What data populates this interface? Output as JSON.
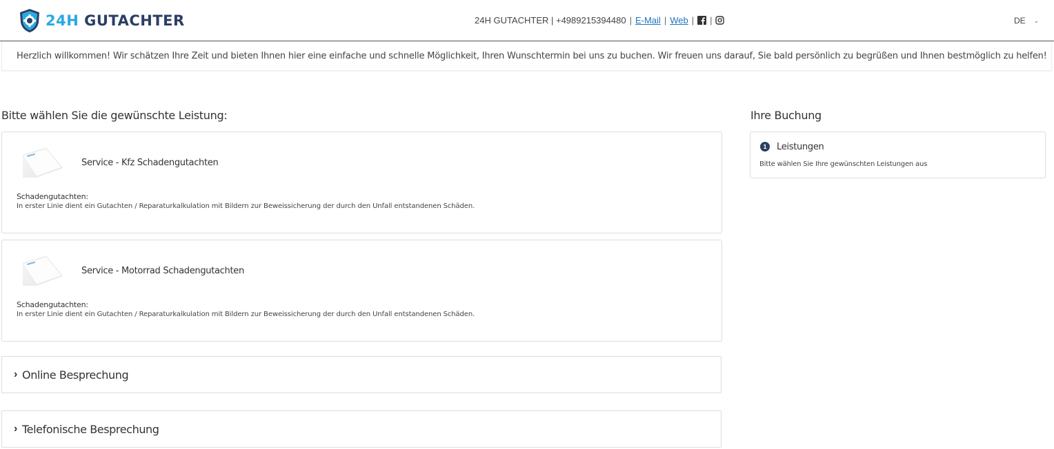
{
  "header": {
    "logo_part1": "24H",
    "logo_part2": " GUTACHTER",
    "contact_prefix": "24H GUTACHTER | +4989215394480",
    "email_label": "E-Mail",
    "web_label": "Web",
    "facebook_icon": "facebook-icon",
    "instagram_icon": "instagram-icon",
    "language": "DE",
    "brand_colors": {
      "light": "#29a9e1",
      "dark": "#2b3e63"
    }
  },
  "welcome": {
    "text": "Herzlich willkommen! Wir schätzen Ihre Zeit und bieten Ihnen hier eine einfache und schnelle Möglichkeit, Ihren Wunschtermin bei uns zu buchen. Wir freuen uns darauf, Sie bald persönlich zu begrüßen und Ihnen bestmöglich zu helfen!"
  },
  "services": {
    "heading": "Bitte wählen Sie die gewünschte Leistung:",
    "items": [
      {
        "title": "Service - Kfz Schadengutachten",
        "desc_heading": "Schadengutachten:",
        "description": "In erster Linie dient ein Gutachten / Reparaturkalkulation mit Bildern zur Beweissicherung der durch den Unfall entstandenen Schäden."
      },
      {
        "title": "Service - Motorrad Schadengutachten",
        "desc_heading": "Schadengutachten:",
        "description": "In erster Linie dient ein Gutachten / Reparaturkalkulation mit Bildern zur Beweissicherung der durch den Unfall entstandenen Schäden."
      }
    ],
    "categories": [
      {
        "label": "Online Besprechung"
      },
      {
        "label": "Telefonische Besprechung"
      }
    ]
  },
  "booking": {
    "heading": "Ihre Buchung",
    "step_number": "1",
    "step_label": "Leistungen",
    "hint": "Bitte wählen Sie Ihre gewünschten Leistungen aus"
  }
}
